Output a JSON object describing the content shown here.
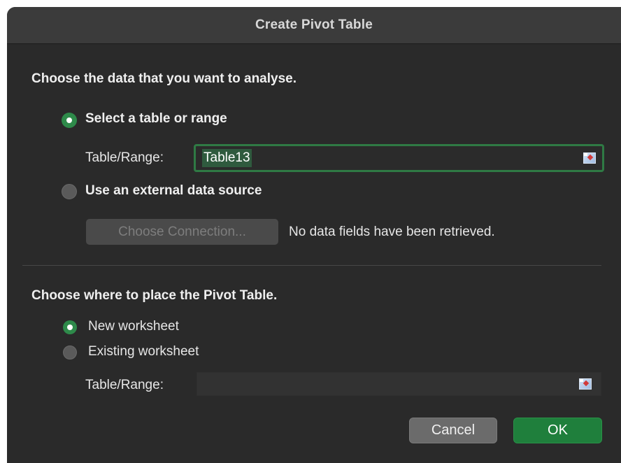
{
  "dialog": {
    "title": "Create Pivot Table"
  },
  "data_section": {
    "heading": "Choose the data that you want to analyse.",
    "options": [
      {
        "label": "Select a table or range",
        "selected": true
      },
      {
        "label": "Use an external data source",
        "selected": false
      }
    ],
    "range_label": "Table/Range:",
    "range_value": "Table13",
    "connection_button": "Choose Connection...",
    "connection_status": "No data fields have been retrieved."
  },
  "place_section": {
    "heading": "Choose where to place the Pivot Table.",
    "options": [
      {
        "label": "New worksheet",
        "selected": true
      },
      {
        "label": "Existing worksheet",
        "selected": false
      }
    ],
    "range_label": "Table/Range:",
    "range_value": ""
  },
  "buttons": {
    "cancel": "Cancel",
    "ok": "OK"
  },
  "colors": {
    "accent": "#2e8a4a",
    "ok_button": "#1f7f3c",
    "dialog_bg": "#2a2a2a",
    "titlebar_bg": "#3b3b3b"
  },
  "icons": {
    "range_picker": "range-picker-icon"
  }
}
